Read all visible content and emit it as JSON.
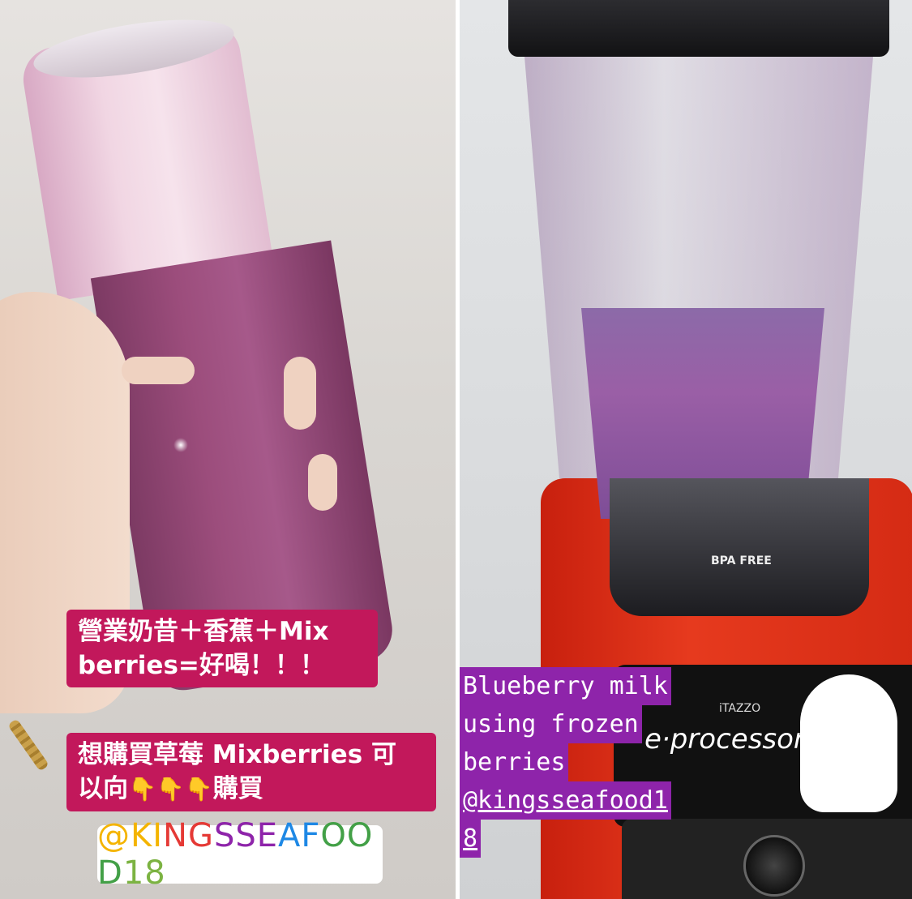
{
  "left_story": {
    "caption_line1": "營業奶昔＋香蕉＋Mix",
    "caption_line2": "berries=好喝！！！",
    "cta_line1": "想購買草莓 Mixberries 可",
    "cta_line2_prefix": "以向",
    "cta_emoji": "👇",
    "cta_line2_suffix": "購買",
    "handle_tag": "@KINGSSEAFOOD18"
  },
  "right_story": {
    "caption_lines": [
      "Blueberry milk",
      "using frozen",
      "berries",
      "@kingsseafood1",
      "8"
    ],
    "appliance_brand_small": "iTAZZO",
    "appliance_brand_big": "e·processor",
    "jar_badge": "BPA FREE"
  },
  "colors": {
    "pink_label": "#c2185b",
    "purple_label": "#8e24aa",
    "blender_red": "#e63a1e",
    "handle_gradient": [
      "#f4b400",
      "#e53935",
      "#8e24aa",
      "#1e88e5",
      "#43a047",
      "#7cb342"
    ]
  }
}
